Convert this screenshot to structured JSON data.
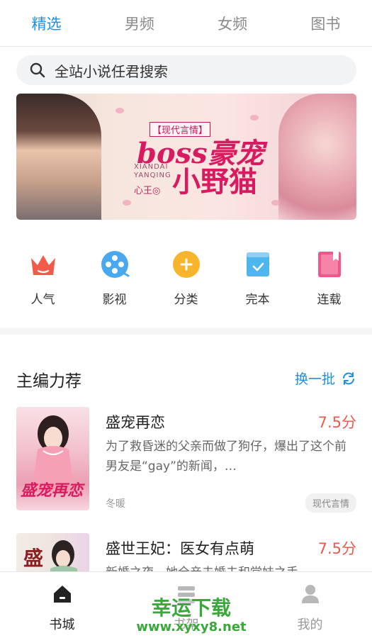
{
  "tabs": [
    {
      "label": "精选",
      "active": true
    },
    {
      "label": "男频",
      "active": false
    },
    {
      "label": "女频",
      "active": false
    },
    {
      "label": "图书",
      "active": false
    }
  ],
  "search": {
    "placeholder": "全站小说任君搜索",
    "icon": "search-icon"
  },
  "banner": {
    "tag": "【现代言情】",
    "title_line1": "boss豪宠",
    "title_line2": "小野猫",
    "subtitle": "XIANDAI YANQING",
    "author": "心王◎"
  },
  "categories": [
    {
      "label": "人气",
      "icon": "crown-icon",
      "color": "#f25a4a"
    },
    {
      "label": "影视",
      "icon": "film-reel-icon",
      "color": "#4aa8f0"
    },
    {
      "label": "分类",
      "icon": "plus-circle-icon",
      "color": "#f7b52c"
    },
    {
      "label": "完本",
      "icon": "check-box-icon",
      "color": "#4db6ef"
    },
    {
      "label": "连载",
      "icon": "bookmark-icon",
      "color": "#f0568a"
    }
  ],
  "section": {
    "title": "主编力荐",
    "more_label": "换一批",
    "more_icon": "refresh-icon"
  },
  "books": [
    {
      "title": "盛宠再恋",
      "score": "7.5分",
      "desc": "为了救昏迷的父亲而做了狗仔，爆出了这个前男友是“gay”的新闻，…",
      "author": "冬暖",
      "tag": "现代言情",
      "cover_text": "盛宠再恋"
    },
    {
      "title": "盛世王妃：医女有点萌",
      "score": "7.5分",
      "desc": "新婚之夜，她全亲未婚夫和堂妹之手",
      "author": "",
      "tag": "",
      "cover_text": "盛"
    }
  ],
  "bottom_nav": [
    {
      "label": "书城",
      "icon": "home-icon",
      "active": true
    },
    {
      "label": "书架",
      "icon": "bookshelf-icon",
      "active": false
    },
    {
      "label": "我的",
      "icon": "user-icon",
      "active": false
    }
  ],
  "watermark": {
    "line1": "幸运下载",
    "line2": "www.xyxy8.net"
  },
  "colors": {
    "accent": "#1f8fe0",
    "score": "#e85b4f",
    "watermark": "#3aa83a"
  }
}
